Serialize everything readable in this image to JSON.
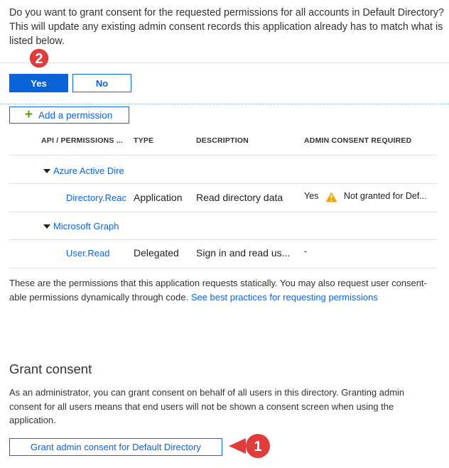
{
  "consent_dialog": {
    "message": "Do you want to grant consent for the requested permissions for all accounts in Default Directory? This will update any existing admin consent records this application already has to match what is listed below.",
    "yes_label": "Yes",
    "no_label": "No"
  },
  "callouts": {
    "first": "1",
    "second": "2"
  },
  "permissions": {
    "add_label": "Add a permission",
    "columns": [
      "API / PERMISSIONS ...",
      "TYPE",
      "DESCRIPTION",
      "ADMIN CONSENT REQUIRED"
    ],
    "groups": [
      {
        "name": "Azure Active Dire",
        "rows": [
          {
            "name": "Directory.Reac",
            "type": "Application",
            "description": "Read directory data",
            "admin_consent": "Yes",
            "status": "Not granted for Def..."
          }
        ]
      },
      {
        "name": "Microsoft Graph",
        "rows": [
          {
            "name": "User.Read",
            "type": "Delegated",
            "description": "Sign in and read us...",
            "admin_consent": "-",
            "status": ""
          }
        ]
      }
    ],
    "info_text": "These are the permissions that this application requests statically. You may also request user consent-able permissions dynamically through code.",
    "info_link": "See best practices for requesting permissions"
  },
  "grant_consent": {
    "title": "Grant consent",
    "description": "As an administrator, you can grant consent on behalf of all users in this directory. Granting admin consent for all users means that end users will not be shown a consent screen when using the application.",
    "button_label": "Grant admin consent for Default Directory"
  },
  "colors": {
    "accent": "#0b62d6",
    "callout": "#e03c3c",
    "warning": "#f7a000",
    "add_icon": "#57a300"
  },
  "icons": {
    "add": "plus-icon",
    "expand": "triangle-down-icon",
    "warning": "warning-icon"
  }
}
